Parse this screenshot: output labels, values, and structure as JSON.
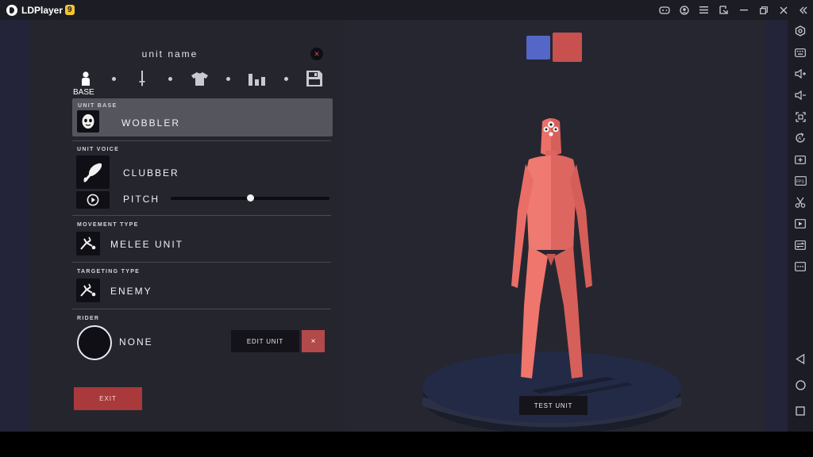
{
  "emulator": {
    "app_name": "LDPlayer",
    "version_badge": "9",
    "title_controls": [
      "gamepad-icon",
      "account-icon",
      "menu-icon",
      "popout-icon",
      "minimize-icon",
      "restore-icon",
      "close-icon",
      "collapse-sidebar-icon"
    ],
    "side_tools": [
      "settings-hex-icon",
      "keyboard-icon",
      "volume-up-icon",
      "volume-down-icon",
      "screenshot-frame-icon",
      "auto-rotate-icon",
      "add-apk-icon",
      "fps-icon",
      "scissors-icon",
      "video-record-icon",
      "sync-icon",
      "more-icon"
    ],
    "nav": [
      "back-icon",
      "home-icon",
      "recents-icon"
    ]
  },
  "editor": {
    "title": "unit name",
    "tabs": [
      {
        "name": "base",
        "icon": "person-icon",
        "label": "BASE",
        "active": true
      },
      {
        "name": "weapon",
        "icon": "sword-icon"
      },
      {
        "name": "clothing",
        "icon": "shirt-icon"
      },
      {
        "name": "stats",
        "icon": "bar-chart-icon"
      },
      {
        "name": "save",
        "icon": "floppy-icon"
      }
    ],
    "unit_base": {
      "label": "UNIT BASE",
      "value": "WOBBLER",
      "icon": "wobbler-face-icon"
    },
    "unit_voice": {
      "label": "UNIT VOICE",
      "value": "CLUBBER",
      "icon": "club-icon",
      "pitch_label": "PITCH",
      "pitch": 0.5
    },
    "movement_type": {
      "label": "MOVEMENT TYPE",
      "value": "MELEE UNIT",
      "icon": "melee-icon"
    },
    "targeting_type": {
      "label": "TARGETING TYPE",
      "value": "ENEMY",
      "icon": "target-icon"
    },
    "rider": {
      "label": "RIDER",
      "value": "NONE"
    },
    "edit_unit_label": "EDIT UNIT",
    "remove_label": "×",
    "exit_label": "EXIT"
  },
  "preview": {
    "team_colors": [
      "#5466c7",
      "#c8504f"
    ],
    "test_unit_label": "TEST UNIT"
  }
}
